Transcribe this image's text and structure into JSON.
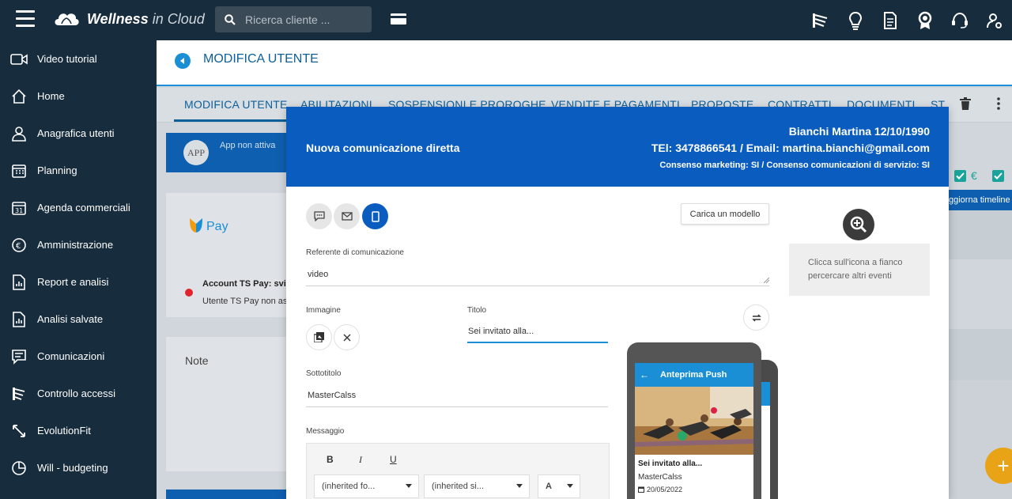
{
  "app": {
    "brand_bold": "Wellness",
    "brand_rest": "in Cloud",
    "search_placeholder": "Ricerca cliente ..."
  },
  "sidebar": {
    "items": [
      {
        "label": "Video tutorial",
        "icon": "video-icon"
      },
      {
        "label": "Home",
        "icon": "home-icon"
      },
      {
        "label": "Anagrafica utenti",
        "icon": "users-icon"
      },
      {
        "label": "Planning",
        "icon": "calendar-grid-icon"
      },
      {
        "label": "Agenda commerciali",
        "icon": "calendar-31-icon"
      },
      {
        "label": "Amministrazione",
        "icon": "euro-icon"
      },
      {
        "label": "Report e analisi",
        "icon": "report-icon"
      },
      {
        "label": "Analisi salvate",
        "icon": "saved-analysis-icon"
      },
      {
        "label": "Comunicazioni",
        "icon": "chat-icon"
      },
      {
        "label": "Controllo accessi",
        "icon": "turnstile-icon"
      },
      {
        "label": "EvolutionFit",
        "icon": "evolution-icon"
      },
      {
        "label": "Will - budgeting",
        "icon": "pie-icon"
      }
    ]
  },
  "header": {
    "title": "MODIFICA UTENTE"
  },
  "tabs": [
    "MODIFICA UTENTE",
    "ABILITAZIONI",
    "SOSPENSIONI E PROROGHE",
    "VENDITE E PAGAMENTI",
    "PROPOSTE",
    "CONTRATTI",
    "DOCUMENTI",
    "ST"
  ],
  "background": {
    "app_circle": "APP",
    "app_status": "App non attiva",
    "pay_label": "Pay",
    "ts_title": "Account TS Pay: svilu",
    "ts_sub": "Utente TS Pay non ass",
    "note_title": "Note",
    "euro": "€",
    "timeline": "ggiorna timeline",
    "fab": "+"
  },
  "modal": {
    "title": "Nuova comunicazione diretta",
    "name": "Bianchi Martina 12/10/1990",
    "contact": "TEl: 3478866541 / Email: martina.bianchi@gmail.com",
    "consent": "Consenso marketing: SI / Consenso comunicazioni di servizio: SI",
    "load_template": "Carica un modello",
    "referente_label": "Referente di comunicazione",
    "referente_value": "video",
    "immagine_label": "Immagine",
    "titolo_label": "Titolo",
    "titolo_value": "Sei invitato alla...",
    "sottotitolo_label": "Sottotitolo",
    "sottotitolo_value": "MasterCalss",
    "messaggio_label": "Messaggio",
    "bold": "B",
    "italic": "I",
    "underline": "U",
    "font_select": "(inherited fo...",
    "size_select": "(inherited si...",
    "color_select": "A",
    "hint": "Clicca sull'icona a fianco percercare altri eventi",
    "preview": {
      "title": "Anteprima Push",
      "msg_title": "Sei invitato alla...",
      "msg_sub": "MasterCalss",
      "date": "20/05/2022"
    }
  },
  "colors": {
    "nav_bg": "#172c3d",
    "accent": "#1b8fd6",
    "modal_head": "#0a5dbf",
    "fab": "#e8a316",
    "check": "#1aa39a"
  }
}
